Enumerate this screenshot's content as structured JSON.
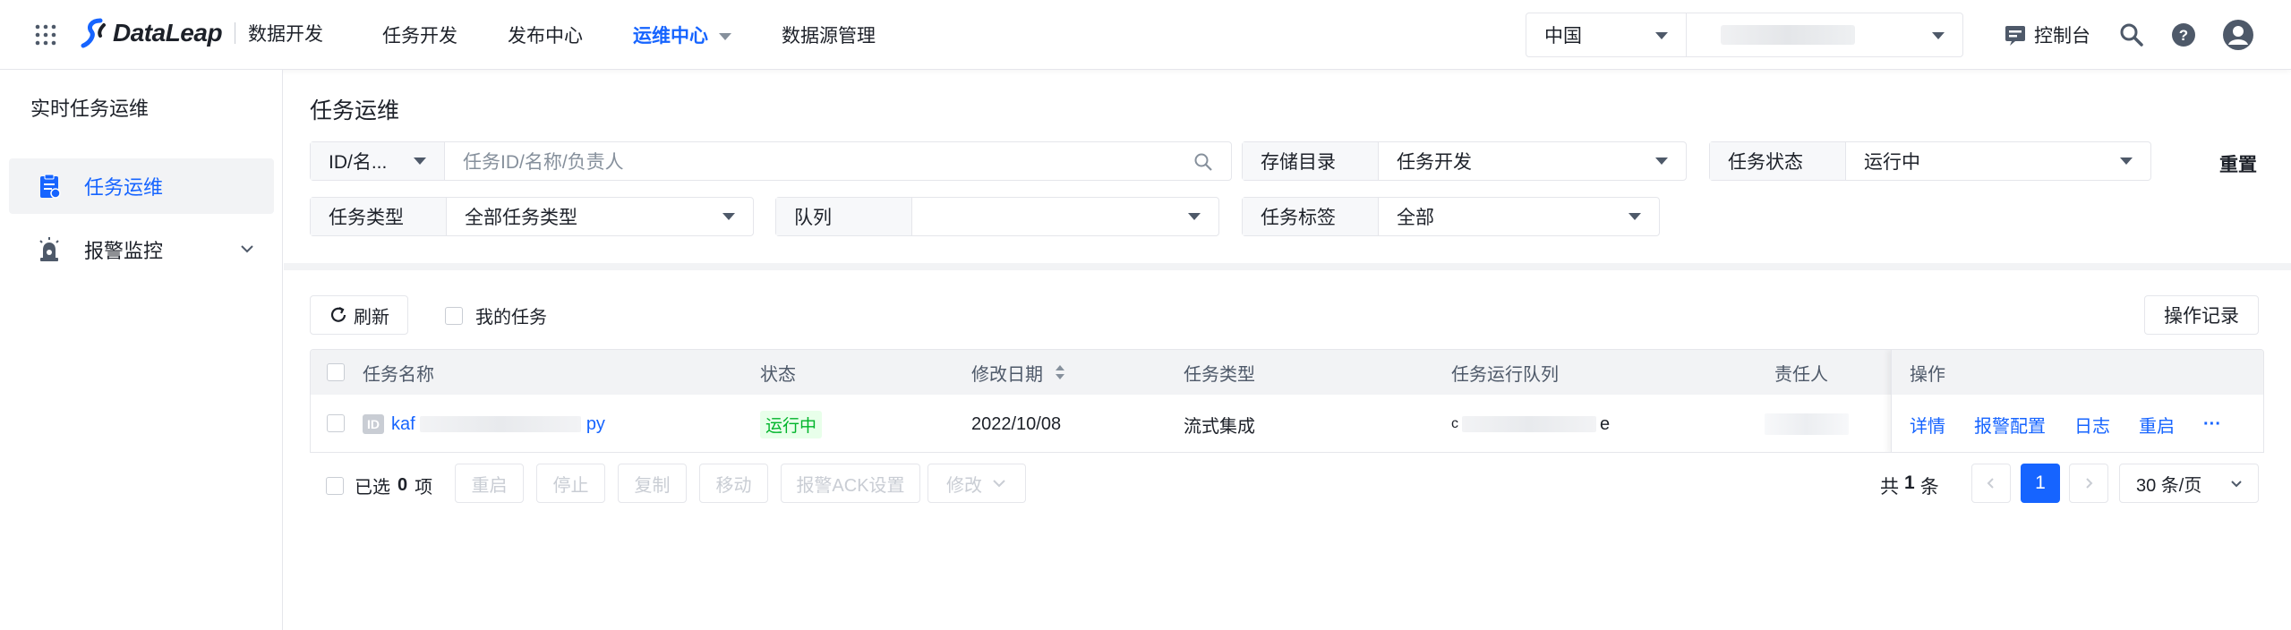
{
  "header": {
    "logo_text": "DataLeap",
    "product_name": "数据开发",
    "nav": [
      {
        "label": "任务开发"
      },
      {
        "label": "发布中心"
      },
      {
        "label": "运维中心"
      },
      {
        "label": "数据源管理"
      }
    ],
    "region": "中国",
    "console_label": "控制台",
    "icons": [
      "apps-grid-icon",
      "search-icon",
      "help-icon",
      "user-avatar-icon"
    ]
  },
  "sidebar": {
    "title": "实时任务运维",
    "items": [
      {
        "label": "任务运维",
        "icon": "task-clipboard-icon",
        "active": true
      },
      {
        "label": "报警监控",
        "icon": "alarm-icon",
        "expandable": true
      }
    ]
  },
  "page": {
    "title": "任务运维",
    "reset_label": "重置",
    "filters": {
      "search_field_label": "ID/名...",
      "search_placeholder": "任务ID/名称/负责人",
      "storage_label": "存储目录",
      "storage_value": "任务开发",
      "status_label": "任务状态",
      "status_value": "运行中",
      "type_label": "任务类型",
      "type_value": "全部任务类型",
      "queue_label": "队列",
      "queue_value": "",
      "tag_label": "任务标签",
      "tag_value": "全部"
    },
    "toolbar": {
      "refresh_label": "刷新",
      "my_tasks_label": "我的任务",
      "op_log_label": "操作记录"
    }
  },
  "table": {
    "columns": [
      "任务名称",
      "状态",
      "修改日期",
      "任务类型",
      "任务运行队列",
      "责任人",
      "操作"
    ],
    "rows": [
      {
        "id_badge": "ID",
        "name_prefix": "kaf",
        "name_suffix": "py",
        "status": "运行中",
        "modified": "2022/10/08",
        "type": "流式集成",
        "queue_prefix": "c",
        "queue_suffix": "e",
        "actions": [
          "详情",
          "报警配置",
          "日志",
          "重启",
          "···"
        ]
      }
    ]
  },
  "footer": {
    "selected_prefix": "已选",
    "selected_count": "0",
    "selected_suffix": "项",
    "batch_actions": [
      "重启",
      "停止",
      "复制",
      "移动",
      "报警ACK设置",
      "修改"
    ],
    "total_prefix": "共",
    "total_count": "1",
    "total_suffix": "条",
    "current_page": "1",
    "page_size": "30 条/页"
  },
  "colors": {
    "accent": "#1664ff",
    "running_green": "#00b42a",
    "running_bg": "#e8ffea",
    "border": "#e5e6eb"
  }
}
